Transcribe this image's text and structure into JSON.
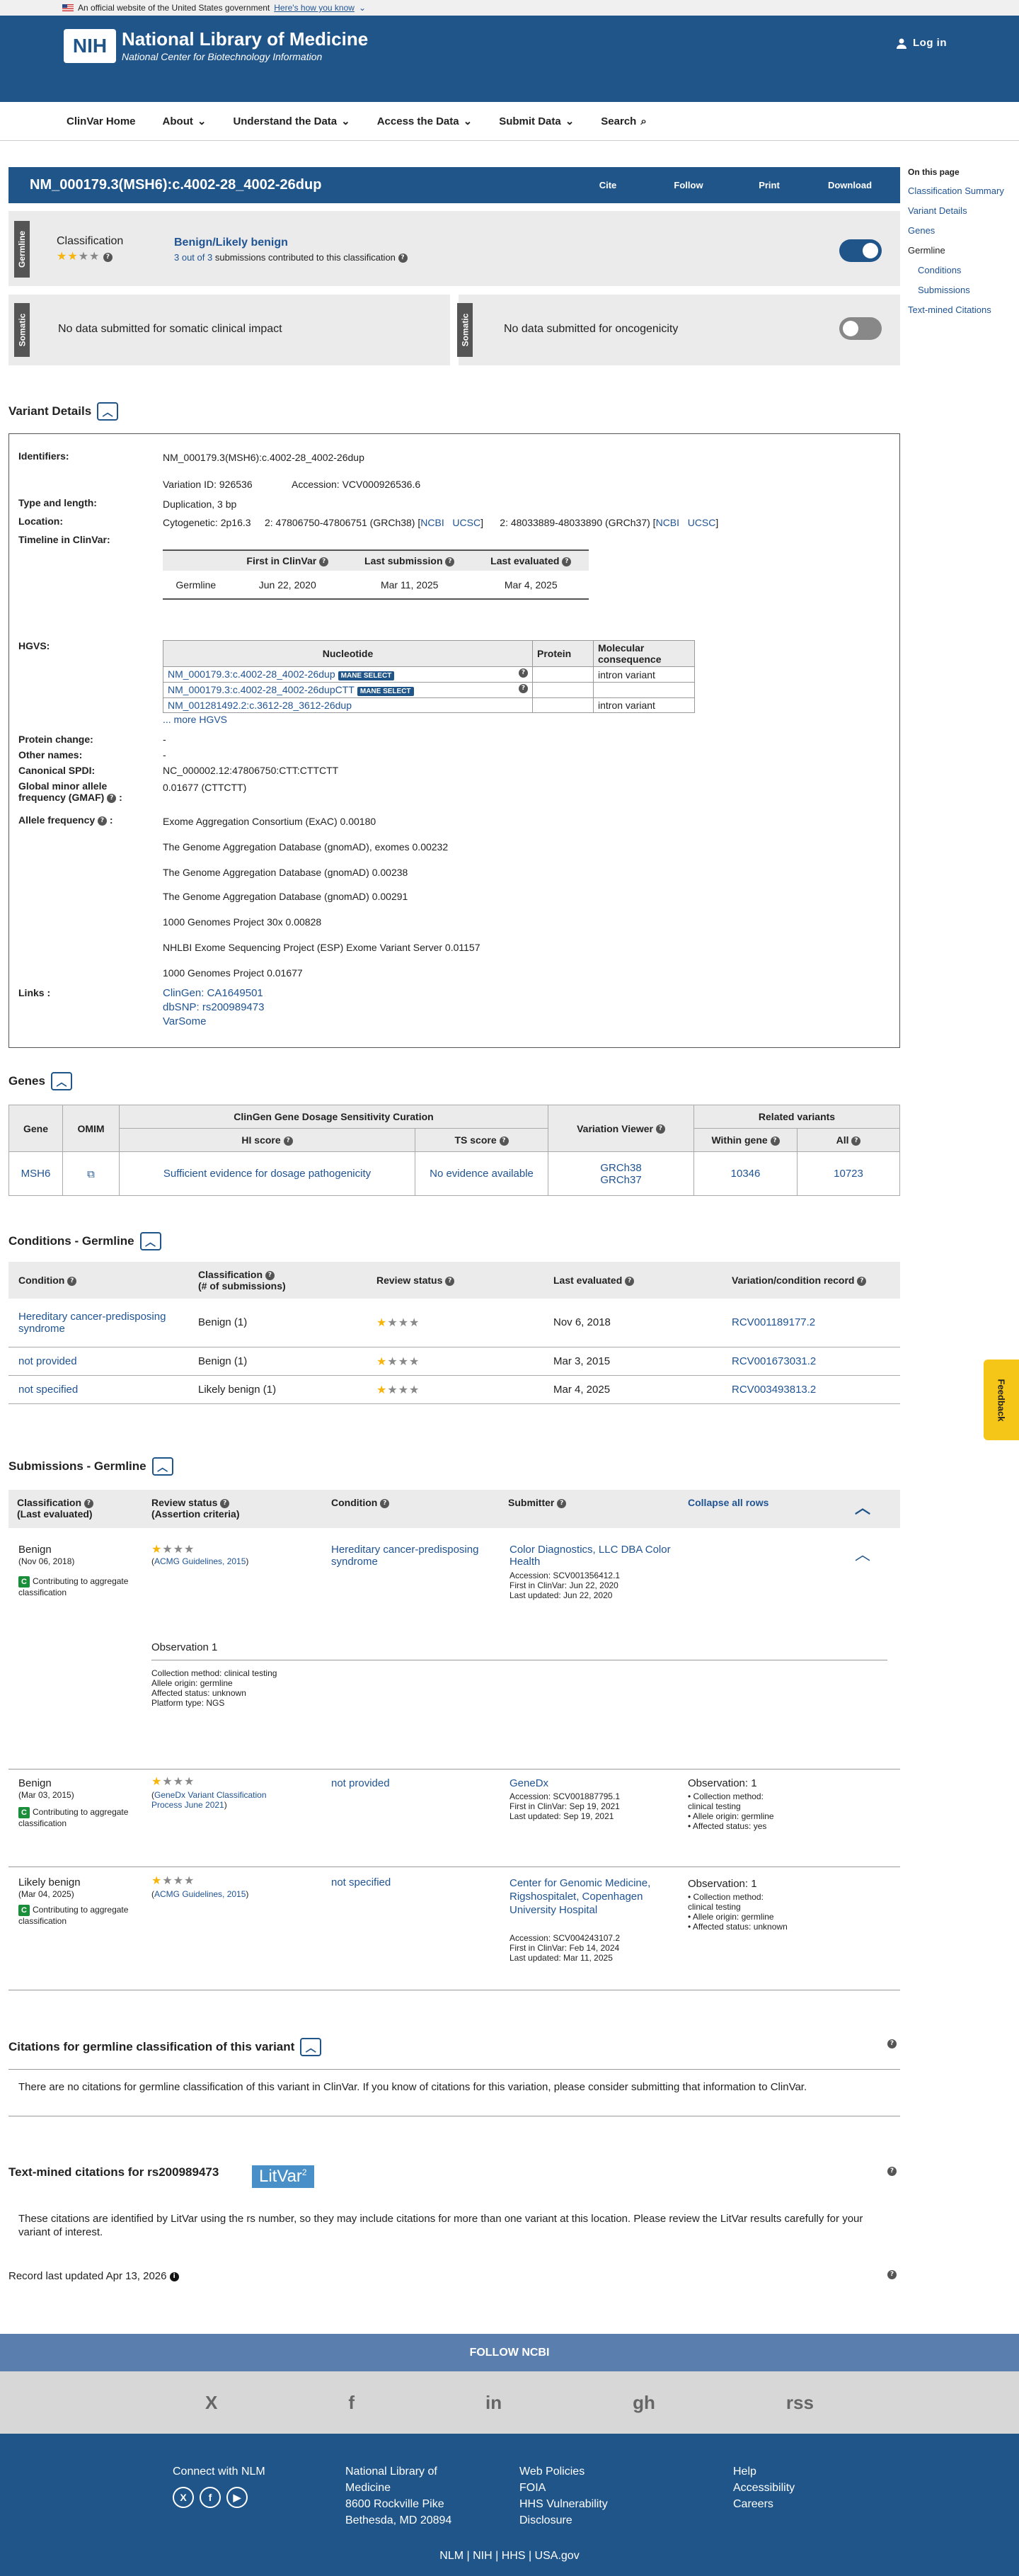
{
  "gov": {
    "text": "An official website of the United States government",
    "link": "Here's how you know"
  },
  "header": {
    "logo": "NIH",
    "title": "National Library of Medicine",
    "subtitle": "National Center for Biotechnology Information",
    "login": "Log in"
  },
  "nav": [
    "ClinVar Home",
    "About",
    "Understand the Data",
    "Access the Data",
    "Submit Data",
    "Search"
  ],
  "titlebar": {
    "title": "NM_000179.3(MSH6):c.4002-28_4002-26dup",
    "buttons": [
      "Cite",
      "Follow",
      "Print",
      "Download"
    ]
  },
  "otp": {
    "heading": "On this page",
    "links": [
      "Classification Summary",
      "Variant Details",
      "Genes",
      "Germline",
      "Conditions",
      "Submissions",
      "Text-mined Citations"
    ]
  },
  "germline": {
    "tab": "Germline",
    "label": "Classification",
    "classification": "Benign/Likely benign",
    "sub_pre": "3 out of 3",
    "sub_post": "submissions contributed to this classification"
  },
  "somatic": {
    "tab": "Somatic",
    "clinical": "No data submitted for somatic clinical impact",
    "onco": "No data submitted for oncogenicity"
  },
  "variant": {
    "heading": "Variant Details",
    "identifiers_label": "Identifiers:",
    "identifier": "NM_000179.3(MSH6):c.4002-28_4002-26dup",
    "variation_id": "Variation ID: 926536",
    "accession": "Accession: VCV000926536.6",
    "type_label": "Type and length:",
    "type": "Duplication, 3 bp",
    "location_label": "Location:",
    "cyto": "Cytogenetic: 2p16.3",
    "loc38": "2: 47806750-47806751 (GRCh38) [",
    "loc37": "2: 48033889-48033890 (GRCh37) [",
    "ncbi": "NCBI",
    "ucsc": "UCSC",
    "timeline_label": "Timeline in ClinVar:",
    "timeline": {
      "headers": [
        "First in ClinVar",
        "Last submission",
        "Last evaluated"
      ],
      "row": [
        "Germline",
        "Jun 22, 2020",
        "Mar 11, 2025",
        "Mar 4, 2025"
      ]
    },
    "hgvs_label": "HGVS:",
    "hgvs": {
      "headers": [
        "Nucleotide",
        "Protein",
        "Molecular consequence"
      ],
      "rows": [
        {
          "n": "NM_000179.3:c.4002-28_4002-26dup",
          "mane": "MANE SELECT",
          "c": "intron variant"
        },
        {
          "n": "NM_000179.3:c.4002-28_4002-26dupCTT",
          "mane": "MANE SELECT",
          "c": ""
        },
        {
          "n": "NM_001281492.2:c.3612-28_3612-26dup",
          "mane": "",
          "c": "intron variant"
        }
      ],
      "more": "... more HGVS"
    },
    "protein_label": "Protein change:",
    "protein": "-",
    "other_label": "Other names:",
    "other": "-",
    "spdi_label": "Canonical SPDI:",
    "spdi": "NC_000002.12:47806750:CTT:CTTCTT",
    "gmaf_label": "Global minor allele frequency (GMAF)",
    "gmaf": "0.01677 (CTTCTT)",
    "af_label": "Allele frequency",
    "af": [
      "Exome Aggregation Consortium (ExAC) 0.00180",
      "The Genome Aggregation Database (gnomAD), exomes 0.00232",
      "The Genome Aggregation Database (gnomAD) 0.00238",
      "The Genome Aggregation Database (gnomAD) 0.00291",
      "1000 Genomes Project 30x 0.00828",
      "NHLBI Exome Sequencing Project (ESP) Exome Variant Server 0.01157",
      "1000 Genomes Project 0.01677"
    ],
    "links_label": "Links :",
    "links": [
      "ClinGen: CA1649501",
      "dbSNP: rs200989473",
      "VarSome"
    ]
  },
  "genes": {
    "heading": "Genes",
    "h_curation": "ClinGen Gene Dosage Sensitivity Curation",
    "h_related": "Related variants",
    "h_gene": "Gene",
    "h_omim": "OMIM",
    "h_hi": "HI score",
    "h_ts": "TS score",
    "h_viewer": "Variation Viewer",
    "h_within": "Within gene",
    "h_all": "All",
    "gene": "MSH6",
    "hi": "Sufficient evidence for dosage pathogenicity",
    "ts": "No evidence available",
    "grch38": "GRCh38",
    "grch37": "GRCh37",
    "within": "10346",
    "all": "10723"
  },
  "conditions": {
    "heading": "Conditions - Germline",
    "headers": [
      "Condition",
      "Classification",
      "(# of submissions)",
      "Review status",
      "Last evaluated",
      "Variation/condition record"
    ],
    "rows": [
      {
        "cond": "Hereditary cancer-predisposing syndrome",
        "cls": "Benign (1)",
        "date": "Nov 6, 2018",
        "rcv": "RCV001189177.2"
      },
      {
        "cond": "not provided",
        "cls": "Benign (1)",
        "date": "Mar 3, 2015",
        "rcv": "RCV001673031.2"
      },
      {
        "cond": "not specified",
        "cls": "Likely benign (1)",
        "date": "Mar 4, 2025",
        "rcv": "RCV003493813.2"
      }
    ]
  },
  "submissions": {
    "heading": "Submissions - Germline",
    "h_cls": "Classification",
    "h_cls2": "(Last evaluated)",
    "h_rev": "Review status",
    "h_rev2": "(Assertion criteria)",
    "h_cond": "Condition",
    "h_sub": "Submitter",
    "collapse": "Collapse all rows",
    "contrib": "Contributing to aggregate classification",
    "s1": {
      "cls": "Benign",
      "date": "(Nov 06, 2018)",
      "crit": "ACMG Guidelines, 2015",
      "cond": "Hereditary cancer-predisposing syndrome",
      "submitter": "Color Diagnostics, LLC DBA Color Health",
      "acc": "Accession: SCV001356412.1",
      "first": "First in ClinVar: Jun 22, 2020",
      "last": "Last updated: Jun 22, 2020",
      "obs": "Observation 1",
      "obs_lines": [
        "Collection method: clinical testing",
        "Allele origin: germline",
        "Affected status: unknown",
        "Platform type: NGS"
      ]
    },
    "s2": {
      "cls": "Benign",
      "date": "(Mar 03, 2015)",
      "crit": "GeneDx Variant Classification Process June 2021",
      "cond": "not provided",
      "submitter": "GeneDx",
      "acc": "Accession: SCV001887795.1",
      "first": "First in ClinVar: Sep 19, 2021",
      "last": "Last updated: Sep 19, 2021",
      "obs": "Observation: 1",
      "obs_lines": [
        "Collection method: clinical testing",
        "Allele origin: germline",
        "Affected status: yes"
      ]
    },
    "s3": {
      "cls": "Likely benign",
      "date": "(Mar 04, 2025)",
      "crit": "ACMG Guidelines, 2015",
      "cond": "not specified",
      "submitter": "Center for Genomic Medicine, Rigshospitalet, Copenhagen University Hospital",
      "acc": "Accession: SCV004243107.2",
      "first": "First in ClinVar: Feb 14, 2024",
      "last": "Last updated: Mar 11, 2025",
      "obs": "Observation: 1",
      "obs_lines": [
        "Collection method: clinical testing",
        "Allele origin: germline",
        "Affected status: unknown"
      ]
    }
  },
  "citations": {
    "heading": "Citations for germline classification of this variant",
    "text": "There are no citations for germline classification of this variant in ClinVar. If you know of citations for this variation, please consider submitting that information to ClinVar."
  },
  "textmined": {
    "heading": "Text-mined citations for rs200989473",
    "logo": "LitVar",
    "sup": "2",
    "text": "These citations are identified by LitVar using the rs number, so they may include citations for more than one variant at this location. Please review the LitVar results carefully for your variant of interest."
  },
  "record": "Record last updated Apr 13, 2026",
  "feedback": "Feedback",
  "footer": {
    "follow": "FOLLOW NCBI",
    "social": [
      "X",
      "f",
      "in",
      "gh",
      "rss"
    ],
    "connect": "Connect with NLM",
    "address": [
      "National Library of",
      "Medicine",
      "8600 Rockville Pike",
      "Bethesda, MD 20894"
    ],
    "col3": [
      "Web Policies",
      "FOIA",
      "HHS Vulnerability",
      "Disclosure"
    ],
    "col4": [
      "Help",
      "Accessibility",
      "Careers"
    ],
    "bottom": "NLM | NIH | HHS | USA.gov"
  },
  "colors": {
    "brand": "#20558a",
    "star": "#f5b50a",
    "contrib": "#1a8e3a"
  }
}
